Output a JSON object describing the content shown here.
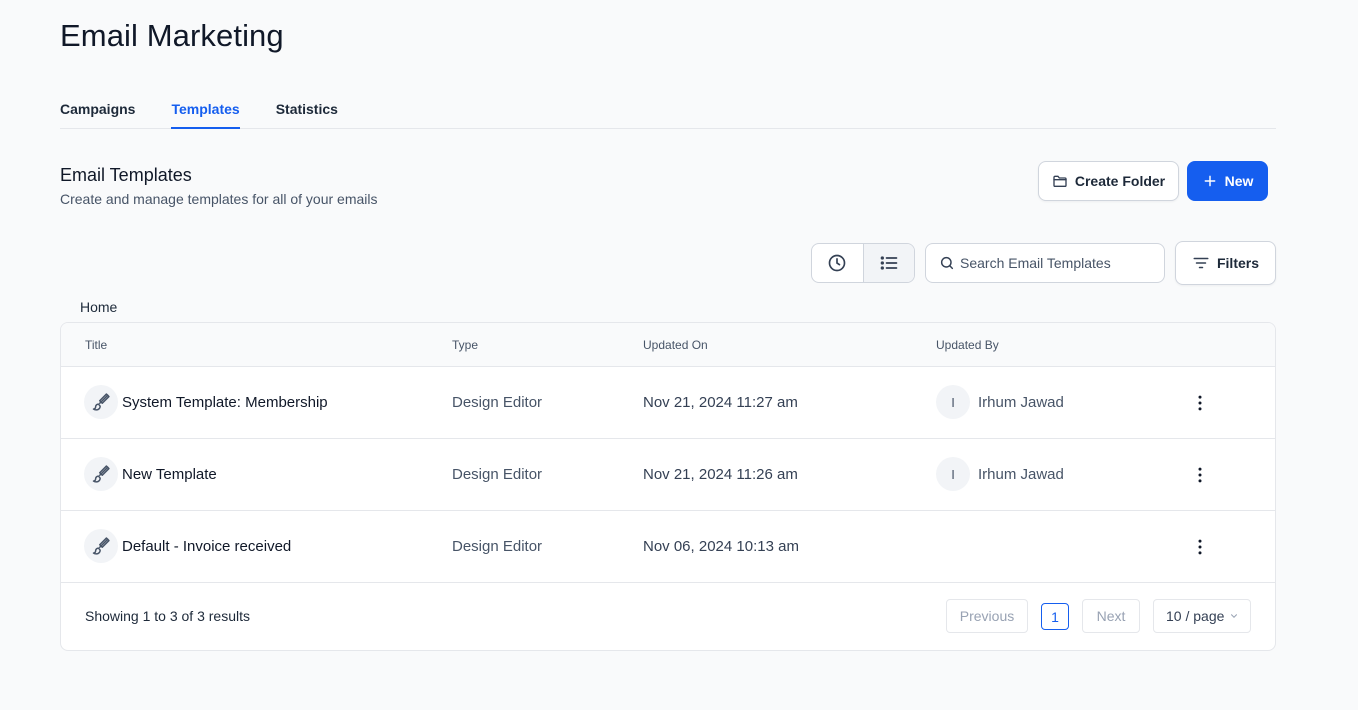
{
  "header": {
    "title": "Email Marketing"
  },
  "tabs": [
    {
      "label": "Campaigns",
      "active": false
    },
    {
      "label": "Templates",
      "active": true
    },
    {
      "label": "Statistics",
      "active": false
    }
  ],
  "section": {
    "title": "Email Templates",
    "subtitle": "Create and manage templates for all of your emails"
  },
  "actions": {
    "create_folder": "Create Folder",
    "new": "New",
    "filters": "Filters"
  },
  "search": {
    "placeholder": "Search Email Templates",
    "value": ""
  },
  "icons": {
    "folder": "folder-icon",
    "plus": "plus-icon",
    "history": "clock-icon",
    "list_view": "list-icon",
    "search": "search-icon",
    "filter": "filter-lines-icon",
    "template": "paintbrush-icon",
    "more": "more-vertical-icon",
    "dropdown": "chevron-down-icon"
  },
  "breadcrumb": {
    "label": "Home"
  },
  "table": {
    "columns": [
      "Title",
      "Type",
      "Updated On",
      "Updated By"
    ],
    "rows": [
      {
        "title": "System Template: Membership",
        "type": "Design Editor",
        "updated_on": "Nov 21, 2024 11:27 am",
        "avatar": "I",
        "updated_by": "Irhum Jawad"
      },
      {
        "title": "New Template",
        "type": "Design Editor",
        "updated_on": "Nov 21, 2024 11:26 am",
        "avatar": "I",
        "updated_by": "Irhum Jawad"
      },
      {
        "title": "Default - Invoice received",
        "type": "Design Editor",
        "updated_on": "Nov 06, 2024 10:13 am",
        "avatar": "",
        "updated_by": ""
      }
    ]
  },
  "pagination": {
    "summary": "Showing 1 to 3 of 3 results",
    "previous": "Previous",
    "current_page": "1",
    "next": "Next",
    "page_size": "10 / page"
  },
  "colors": {
    "accent": "#155eef",
    "background": "#f9fafb",
    "border": "#e5e7eb"
  }
}
